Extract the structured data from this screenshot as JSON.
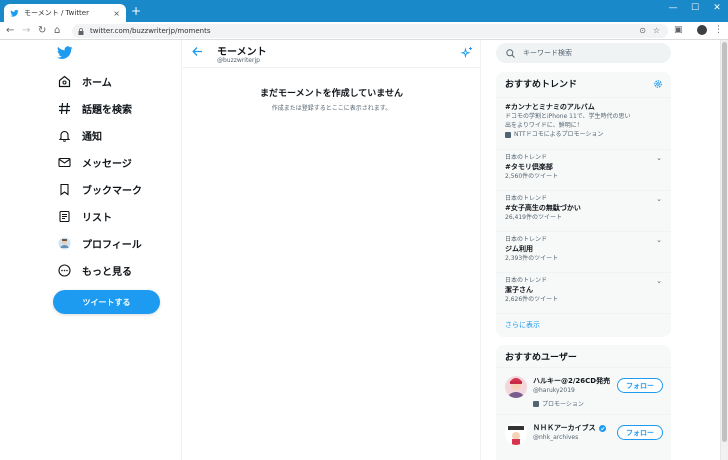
{
  "browser": {
    "tab_title": "モーメント / Twitter",
    "tab_close": "×",
    "new_tab": "+",
    "url": "twitter.com/buzzwriterjp/moments",
    "win_min": "—",
    "win_max": "☐",
    "win_close": "✕"
  },
  "nav": {
    "items": [
      {
        "label": "ホーム"
      },
      {
        "label": "話題を検索"
      },
      {
        "label": "通知"
      },
      {
        "label": "メッセージ"
      },
      {
        "label": "ブックマーク"
      },
      {
        "label": "リスト"
      },
      {
        "label": "プロフィール"
      },
      {
        "label": "もっと見る"
      }
    ],
    "tweet_button": "ツイートする"
  },
  "header": {
    "title": "モーメント",
    "handle": "@buzzwriterjp"
  },
  "empty": {
    "title": "まだモーメントを作成していません",
    "subtitle": "作成または登録するとここに表示されます。"
  },
  "search": {
    "placeholder": "キーワード検索"
  },
  "trends": {
    "title": "おすすめトレンド",
    "promoted": {
      "name": "#カンナとミナミのアルバム",
      "desc1": "ドコモの学割とiPhone 11で、学生時代の思い",
      "desc2": "出をよりワイドに、鮮明に！",
      "promo": "NTTドコモによるプロモーション"
    },
    "items": [
      {
        "context": "日本のトレンド",
        "name": "#タモリ倶楽部",
        "count": "2,560件のツイート"
      },
      {
        "context": "日本のトレンド",
        "name": "#女子高生の無駄づかい",
        "count": "26,419件のツイート"
      },
      {
        "context": "日本のトレンド",
        "name": "ジム利用",
        "count": "2,393件のツイート"
      },
      {
        "context": "日本のトレンド",
        "name": "潔子さん",
        "count": "2,626件のツイート"
      }
    ],
    "more": "さらに表示"
  },
  "users": {
    "title": "おすすめユーザー",
    "items": [
      {
        "name": "ハルキー@2/26CD発売",
        "handle": "@haruky2019",
        "promo": "プロモーション",
        "follow": "フォロー"
      },
      {
        "name": "ＮＨＫアーカイブス",
        "handle": "@nhk_archives",
        "follow": "フォロー"
      }
    ]
  },
  "colors": {
    "accent": "#1d9bf0",
    "chrome": "#1a89c9"
  }
}
